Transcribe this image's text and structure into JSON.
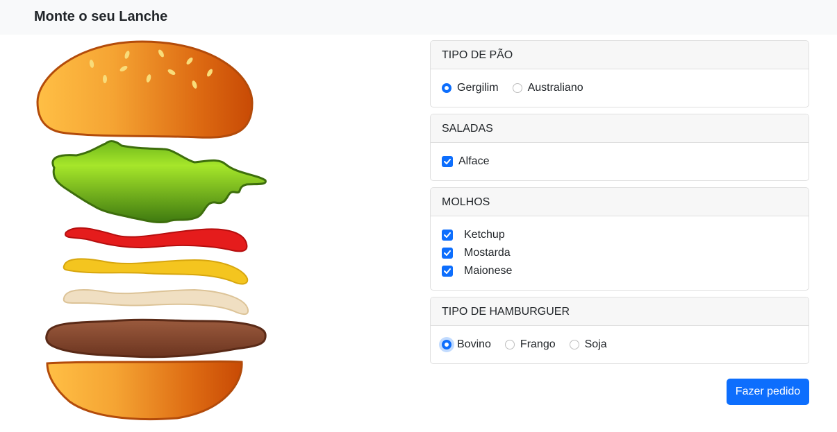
{
  "navbar": {
    "brand": "Monte o seu Lanche"
  },
  "sections": {
    "pao": {
      "title": "TIPO DE PÃO",
      "options": [
        {
          "label": "Gergilim",
          "selected": true
        },
        {
          "label": "Australiano",
          "selected": false
        }
      ]
    },
    "saladas": {
      "title": "SALADAS",
      "options": [
        {
          "label": "Alface",
          "checked": true
        }
      ]
    },
    "molhos": {
      "title": "MOLHOS",
      "options": [
        {
          "label": "Ketchup",
          "checked": true
        },
        {
          "label": "Mostarda",
          "checked": true
        },
        {
          "label": "Maionese",
          "checked": true
        }
      ]
    },
    "hamburguer": {
      "title": "TIPO DE HAMBURGUER",
      "options": [
        {
          "label": "Bovino",
          "selected": true
        },
        {
          "label": "Frango",
          "selected": false
        },
        {
          "label": "Soja",
          "selected": false
        }
      ]
    }
  },
  "actions": {
    "order_label": "Fazer pedido"
  },
  "colors": {
    "accent": "#0d6efd",
    "navbar_bg": "#f8f9fa",
    "bun": "#f39c2c",
    "lettuce": "#7ac51f",
    "ketchup": "#e3161b",
    "mustard": "#f3c21d",
    "mayo": "#f0e0c4",
    "patty": "#7a3f25"
  },
  "burger_layers": [
    "top-bun",
    "lettuce",
    "ketchup",
    "mustard",
    "mayonnaise",
    "patty",
    "bottom-bun"
  ]
}
